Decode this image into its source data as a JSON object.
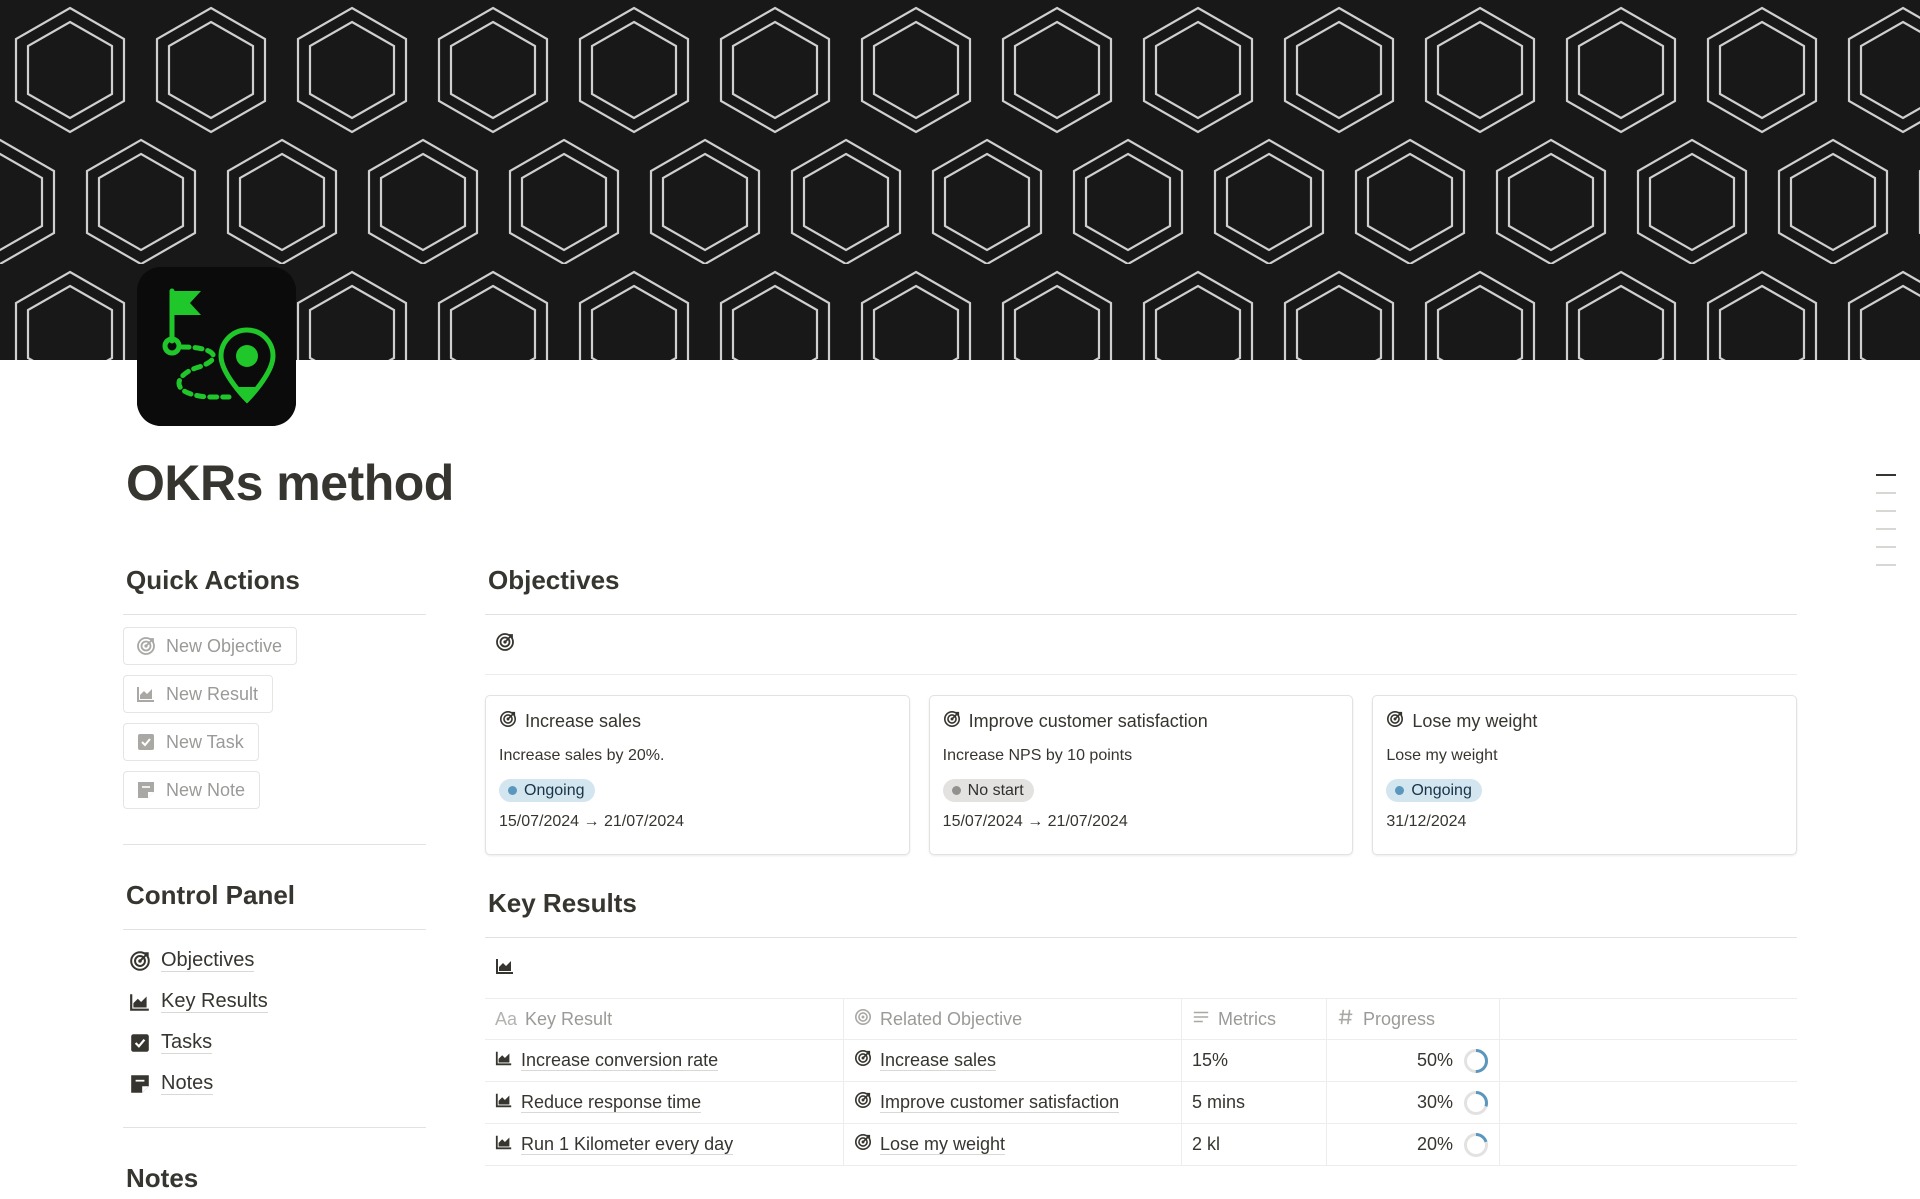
{
  "page": {
    "title": "OKRs method",
    "colors": {
      "accent_green": "#1fc72a",
      "cover_bg": "#181818",
      "ongoing_bg": "#d3e5ef",
      "ongoing_dot": "#5b97bd",
      "nostart_bg": "#e3e2e0"
    }
  },
  "quick_actions": {
    "heading": "Quick Actions",
    "buttons": [
      {
        "label": "New Objective",
        "icon": "target-icon"
      },
      {
        "label": "New Result",
        "icon": "chart-icon"
      },
      {
        "label": "New Task",
        "icon": "checkbox-icon"
      },
      {
        "label": "New Note",
        "icon": "note-icon"
      }
    ]
  },
  "control_panel": {
    "heading": "Control Panel",
    "items": [
      {
        "label": "Objectives",
        "icon": "target-icon"
      },
      {
        "label": "Key Results",
        "icon": "chart-icon"
      },
      {
        "label": "Tasks",
        "icon": "checkbox-icon"
      },
      {
        "label": "Notes",
        "icon": "note-icon"
      }
    ]
  },
  "notes": {
    "heading": "Notes"
  },
  "objectives": {
    "heading": "Objectives",
    "cards": [
      {
        "title": "Increase sales",
        "description": "Increase sales by 20%.",
        "status": "Ongoing",
        "date": "15/07/2024 → 21/07/2024"
      },
      {
        "title": "Improve customer satisfaction",
        "description": "Increase NPS by 10 points",
        "status": "No start",
        "date": "15/07/2024 → 21/07/2024"
      },
      {
        "title": "Lose my weight",
        "description": "Lose my weight",
        "status": "Ongoing",
        "date": "31/12/2024"
      }
    ]
  },
  "key_results": {
    "heading": "Key Results",
    "columns": {
      "key_result": "Key Result",
      "related_objective": "Related Objective",
      "metrics": "Metrics",
      "progress": "Progress",
      "key_result_prefix": "Aa"
    },
    "rows": [
      {
        "key_result": "Increase conversion rate",
        "related_objective": "Increase sales",
        "metrics": "15%",
        "progress": "50%",
        "progress_value": 0.5
      },
      {
        "key_result": "Reduce response time",
        "related_objective": "Improve customer satisfaction",
        "metrics": "5 mins",
        "progress": "30%",
        "progress_value": 0.3
      },
      {
        "key_result": "Run 1 Kilometer every day",
        "related_objective": "Lose my weight",
        "metrics": "2 kl",
        "progress": "20%",
        "progress_value": 0.2
      }
    ]
  }
}
